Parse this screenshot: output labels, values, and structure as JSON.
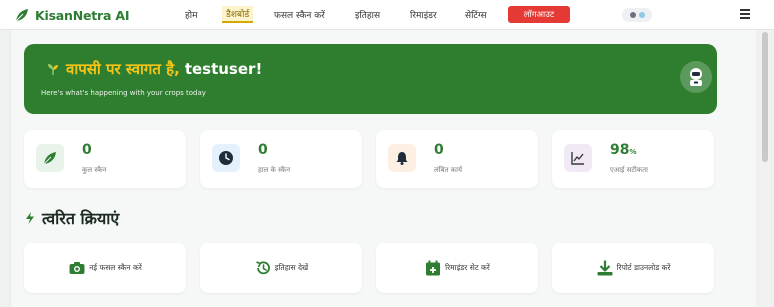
{
  "brand": {
    "name": "KisanNetra AI",
    "icon": "leaf-icon",
    "color": "#2e7d32"
  },
  "nav": {
    "links": [
      {
        "label": "होम",
        "active": false
      },
      {
        "label": "डैशबोर्ड",
        "active": true
      },
      {
        "label": "फसल स्कैन करें",
        "active": false
      },
      {
        "label": "इतिहास",
        "active": false
      },
      {
        "label": "रिमाइंडर",
        "active": false
      },
      {
        "label": "सेटिंग्स",
        "active": false
      }
    ],
    "logout_label": "लॉगआउट",
    "logout_color": "#e53935"
  },
  "banner": {
    "greeting": "वापसी पर स्वागत है,",
    "username": "testuser",
    "punct": "!",
    "subtitle": "Here's what's happening with your crops today",
    "background": "#2f7d2f",
    "accent": "#f5c518",
    "avatar_icon": "robot-icon"
  },
  "stats": [
    {
      "value": "0",
      "unit": "",
      "label": "कुल स्कैन",
      "icon": "leaf-icon",
      "icon_bg": "#e8f3ea",
      "icon_color": "#2e7d32"
    },
    {
      "value": "0",
      "unit": "",
      "label": "हाल के स्कैन",
      "icon": "clock-icon",
      "icon_bg": "#e4f0fb",
      "icon_color": "#1f2d3a"
    },
    {
      "value": "0",
      "unit": "",
      "label": "लंबित कार्य",
      "icon": "bell-icon",
      "icon_bg": "#fdf0e3",
      "icon_color": "#1f2d3a"
    },
    {
      "value": "98",
      "unit": "%",
      "label": "एआई सटीकता",
      "icon": "chart-line-icon",
      "icon_bg": "#f1eaf6",
      "icon_color": "#3a3a3a"
    }
  ],
  "quick_actions": {
    "title": "त्वरित क्रियाएं",
    "items": [
      {
        "label": "नई फसल स्कैन करें",
        "icon": "camera-icon"
      },
      {
        "label": "इतिहास देखें",
        "icon": "history-icon"
      },
      {
        "label": "रिमाइंडर सेट करें",
        "icon": "calendar-plus-icon"
      },
      {
        "label": "रिपोर्ट डाउनलोड करें",
        "icon": "download-icon"
      }
    ]
  }
}
